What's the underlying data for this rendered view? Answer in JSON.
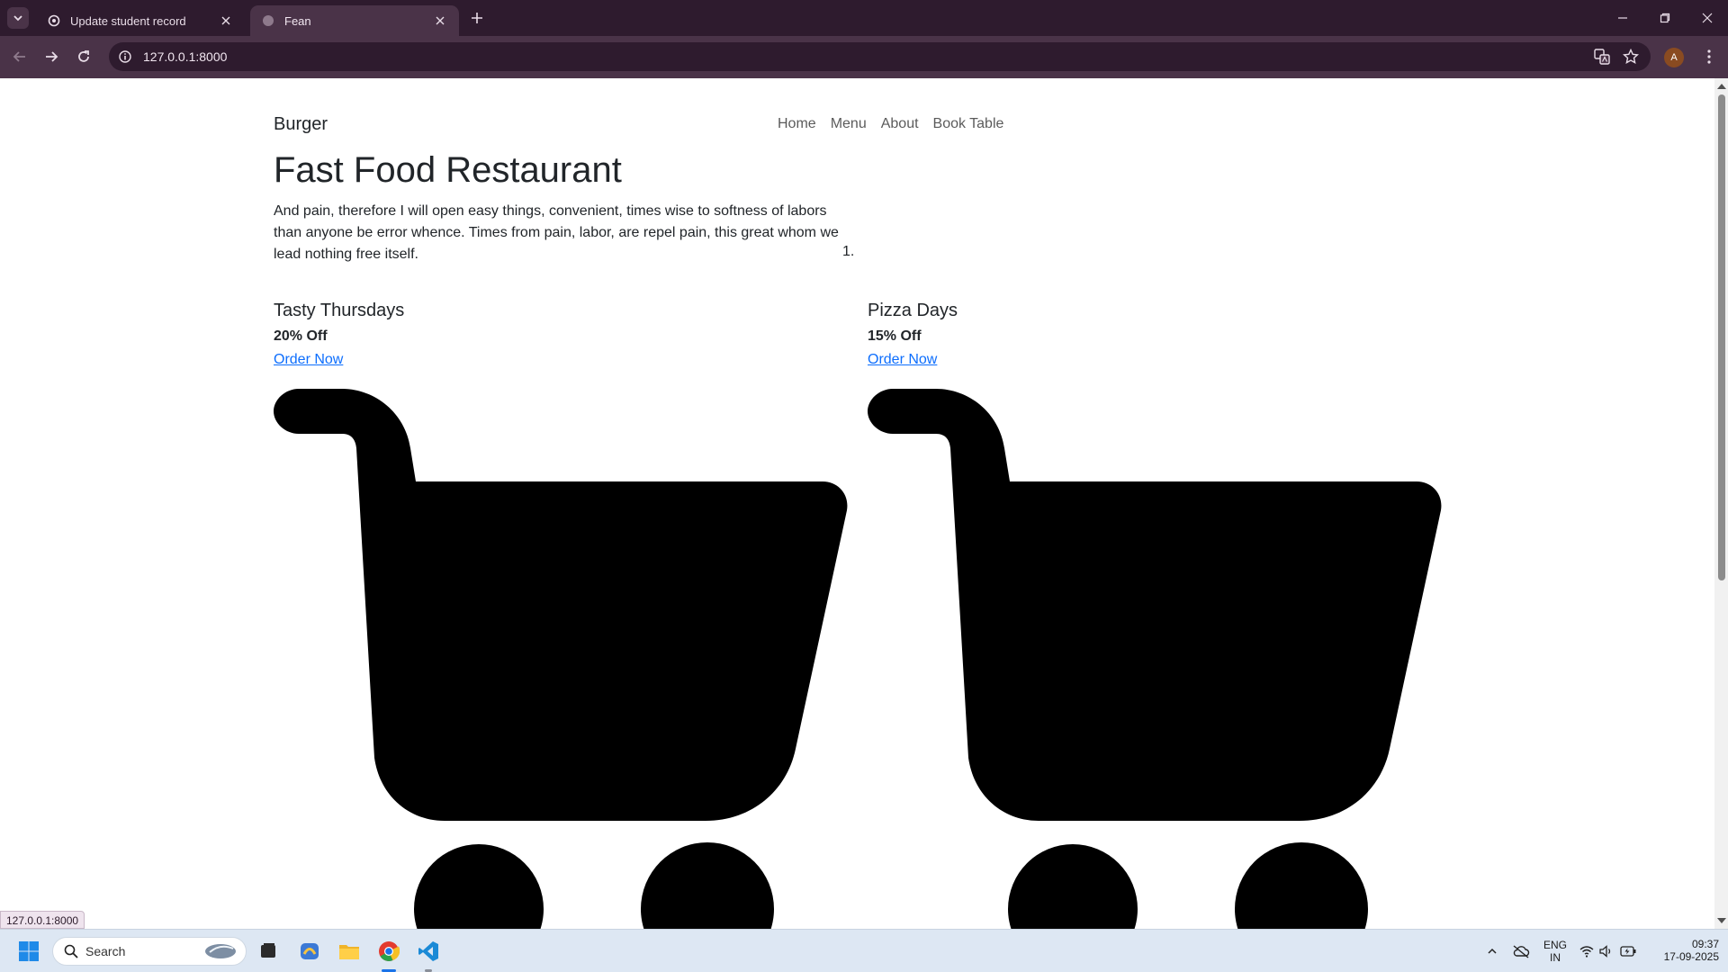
{
  "browser": {
    "tabs": [
      {
        "title": "Update student record",
        "active": false
      },
      {
        "title": "Fean",
        "active": true
      }
    ],
    "url": "127.0.0.1:8000",
    "profile_initial": "A",
    "status_url": "127.0.0.1:8000"
  },
  "page": {
    "brand": "Burger",
    "nav": [
      "Home",
      "Menu",
      "About",
      "Book Table"
    ],
    "hero_title": "Fast Food Restaurant",
    "hero_text": "And pain, therefore I will open easy things, convenient, times wise to softness of labors than anyone be error whence. Times from pain, labor, are repel pain, this great whom we lead nothing free itself.",
    "list_marker": "1.",
    "offers": [
      {
        "title": "Tasty Thursdays",
        "discount": "20% Off",
        "cta": "Order Now"
      },
      {
        "title": "Pizza Days",
        "discount": "15% Off",
        "cta": "Order Now"
      }
    ]
  },
  "taskbar": {
    "search_label": "Search",
    "lang": "ENG",
    "region": "IN",
    "time": "09:37",
    "date": "17-09-2025"
  },
  "colors": {
    "tab_strip": "#2e1b2e",
    "toolbar": "#4a3348",
    "link": "#0d6efd",
    "taskbar": "#dde7f3"
  }
}
